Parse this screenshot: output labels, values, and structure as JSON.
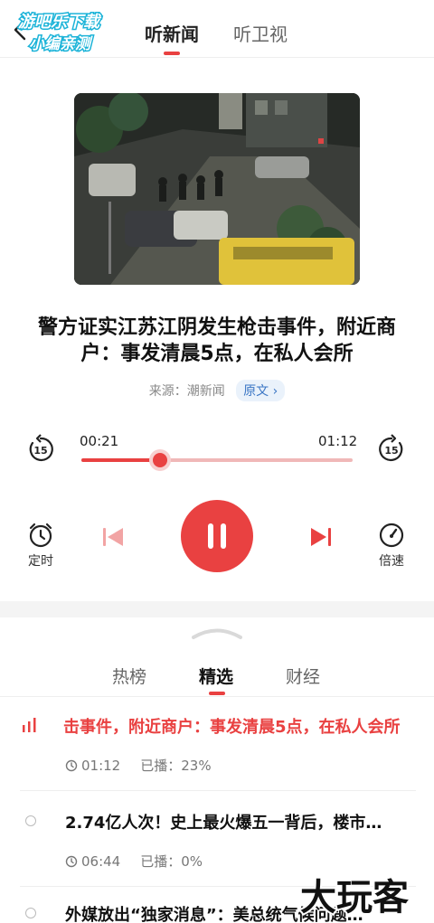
{
  "watermark_top": {
    "line1": "游吧乐下载",
    "line2": "小编亲测"
  },
  "header": {
    "tabs": [
      {
        "label": "听新闻",
        "active": true
      },
      {
        "label": "听卫视",
        "active": false
      }
    ]
  },
  "article": {
    "title": "警方证实江苏江阴发生枪击事件，附近商户：事发清晨5点，在私人会所",
    "source": "来源：潮新闻",
    "source_link": "原文 ›"
  },
  "player": {
    "current_time": "00:21",
    "total_time": "01:12",
    "progress_fraction": 0.29,
    "rewind_label": "15",
    "forward_label": "15",
    "timer_label": "定时",
    "speed_label": "倍速",
    "state": "playing"
  },
  "playlist": {
    "tabs": [
      {
        "label": "热榜",
        "active": false
      },
      {
        "label": "精选",
        "active": true
      },
      {
        "label": "财经",
        "active": false
      }
    ],
    "items": [
      {
        "title": "击事件，附近商户：事发清晨5点，在私人会所",
        "duration": "01:12",
        "played": "已播：23%",
        "playing": true
      },
      {
        "title": "2.74亿人次！史上最火爆五一背后，楼市…",
        "duration": "06:44",
        "played": "已播：0%",
        "playing": false
      },
      {
        "title": "外媒放出“独家消息”：美总统气候问题…",
        "playing": false
      }
    ]
  },
  "watermark_bottom": "大玩客",
  "colors": {
    "accent": "#e94141",
    "link": "#3a75c4"
  }
}
